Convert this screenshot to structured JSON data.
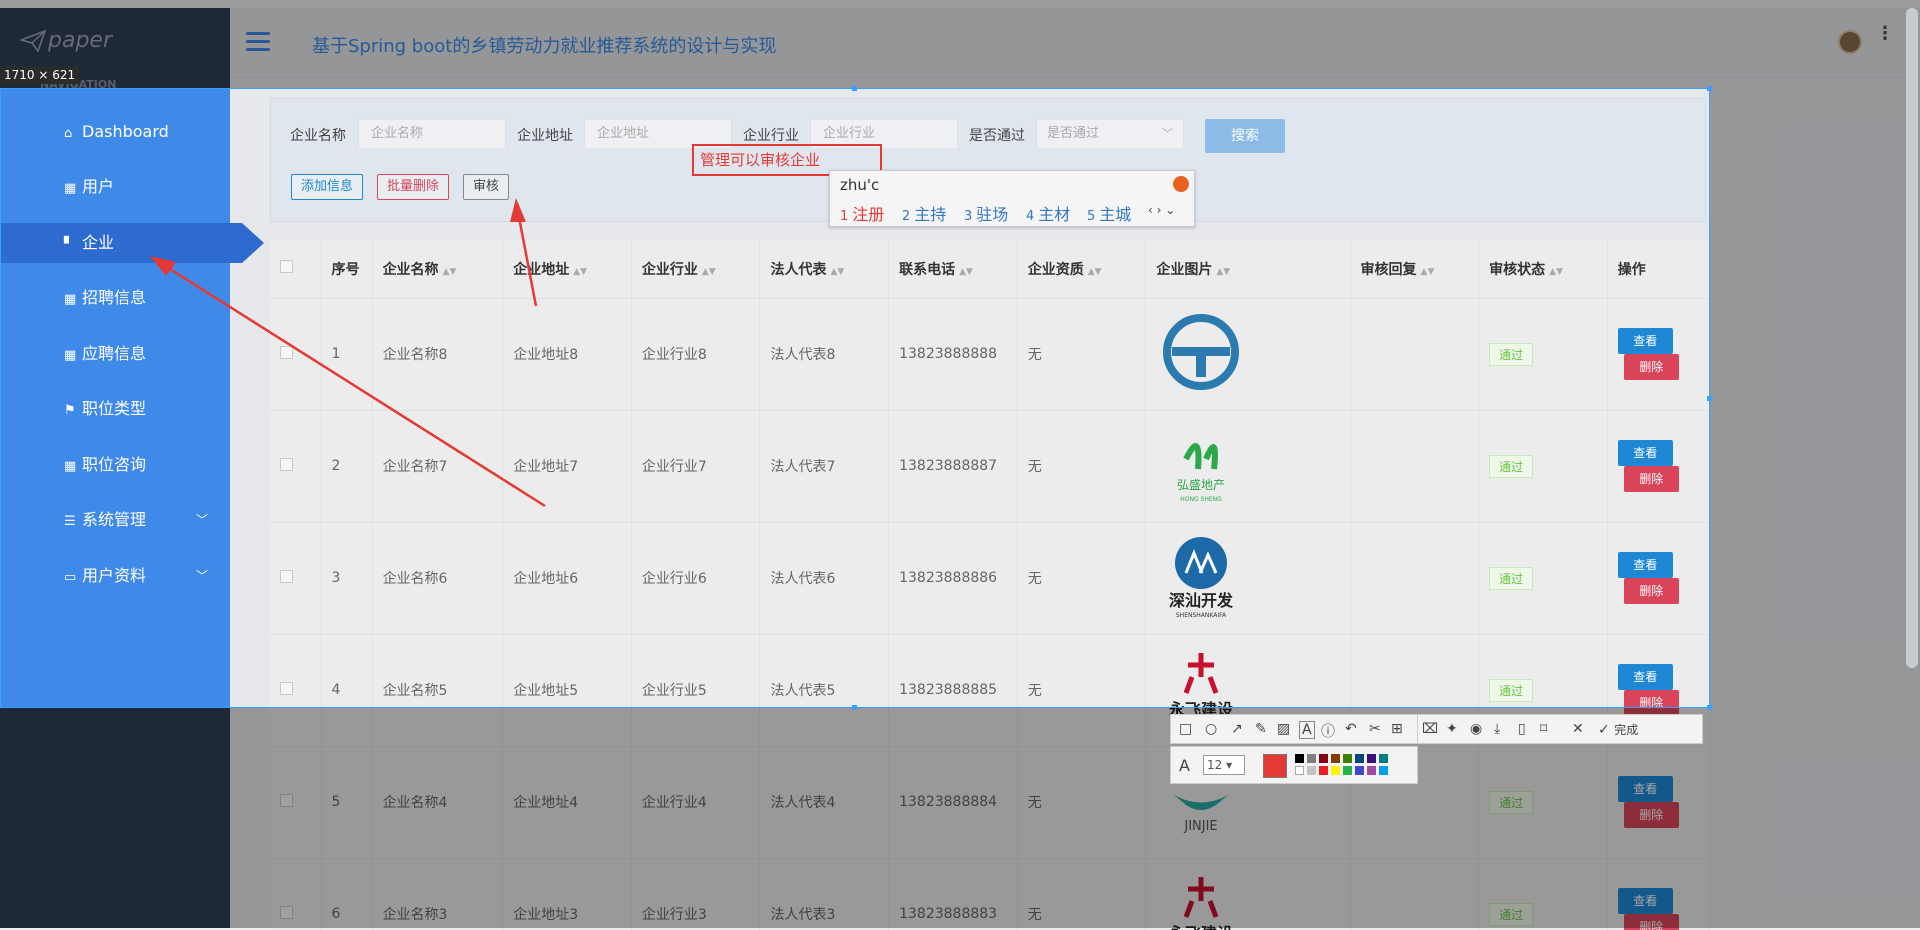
{
  "app": {
    "logo_text": "paper",
    "nav_header": "NAVIGATION",
    "page_title": "基于Spring boot的乡镇劳动力就业推荐系统的设计与实现"
  },
  "sidebar": {
    "items": [
      {
        "label": "Dashboard",
        "icon": "home-icon"
      },
      {
        "label": "用户",
        "icon": "grid-icon"
      },
      {
        "label": "企业",
        "icon": "building-icon"
      },
      {
        "label": "招聘信息",
        "icon": "grid-icon"
      },
      {
        "label": "应聘信息",
        "icon": "grid-icon"
      },
      {
        "label": "职位类型",
        "icon": "flag-icon"
      },
      {
        "label": "职位咨询",
        "icon": "grid-icon"
      },
      {
        "label": "系统管理",
        "icon": "sliders-icon"
      },
      {
        "label": "用户资料",
        "icon": "card-icon"
      }
    ]
  },
  "filter": {
    "name_label": "企业名称",
    "name_placeholder": "企业名称",
    "address_label": "企业地址",
    "address_placeholder": "企业地址",
    "industry_label": "企业行业",
    "industry_placeholder": "企业行业",
    "passed_label": "是否通过",
    "passed_placeholder": "是否通过",
    "search_label": "搜索"
  },
  "actions": {
    "add": "添加信息",
    "batch_delete": "批量删除",
    "audit": "审核"
  },
  "annotation": {
    "text": "管理可以审核企业"
  },
  "ime": {
    "typed": "zhu'c",
    "candidates": [
      "注册",
      "主持",
      "驻场",
      "主材",
      "主城"
    ],
    "nums": [
      "1",
      "2",
      "3",
      "4",
      "5"
    ],
    "pager": "‹ › ⌄"
  },
  "screenshot_tool": {
    "size": "1710 × 621",
    "font_size": "12",
    "done": "完成"
  },
  "table": {
    "headers": [
      "序号",
      "企业名称",
      "企业地址",
      "企业行业",
      "法人代表",
      "联系电话",
      "企业资质",
      "企业图片",
      "审核回复",
      "审核状态",
      "操作"
    ],
    "view_label": "查看",
    "delete_label": "删除",
    "rows": [
      {
        "no": "1",
        "name": "企业名称8",
        "address": "企业地址8",
        "industry": "企业行业8",
        "legal": "法人代表8",
        "phone": "13823888888",
        "qual": "无",
        "reply": "",
        "status": "通过",
        "logo": "T-logo"
      },
      {
        "no": "2",
        "name": "企业名称7",
        "address": "企业地址7",
        "industry": "企业行业7",
        "legal": "法人代表7",
        "phone": "13823888887",
        "qual": "无",
        "reply": "",
        "status": "通过",
        "logo": "hongsheng-logo",
        "logo_text": "弘盛地产",
        "logo_sub": "HONG SHENG"
      },
      {
        "no": "3",
        "name": "企业名称6",
        "address": "企业地址6",
        "industry": "企业行业6",
        "legal": "法人代表6",
        "phone": "13823888886",
        "qual": "无",
        "reply": "",
        "status": "通过",
        "logo": "shenshan-logo",
        "logo_text": "深汕开发",
        "logo_sub": "SHENSHANKAIFA"
      },
      {
        "no": "4",
        "name": "企业名称5",
        "address": "企业地址5",
        "industry": "企业行业5",
        "legal": "法人代表5",
        "phone": "13823888885",
        "qual": "无",
        "reply": "",
        "status": "通过",
        "logo": "yongfei-logo",
        "logo_text": "永飞建设"
      },
      {
        "no": "5",
        "name": "企业名称4",
        "address": "企业地址4",
        "industry": "企业行业4",
        "legal": "法人代表4",
        "phone": "13823888884",
        "qual": "无",
        "reply": "",
        "status": "通过",
        "logo": "jinjie-logo",
        "logo_text": "JINJIE"
      },
      {
        "no": "6",
        "name": "企业名称3",
        "address": "企业地址3",
        "industry": "企业行业3",
        "legal": "法人代表3",
        "phone": "13823888883",
        "qual": "无",
        "reply": "",
        "status": "通过",
        "logo": "yongfei-logo",
        "logo_text": "永飞建设"
      }
    ]
  },
  "colors": {
    "primary": "#3f8ae8",
    "sidebar_dark": "#2f3e57",
    "danger": "#d9445a",
    "annot": "#e53935"
  }
}
